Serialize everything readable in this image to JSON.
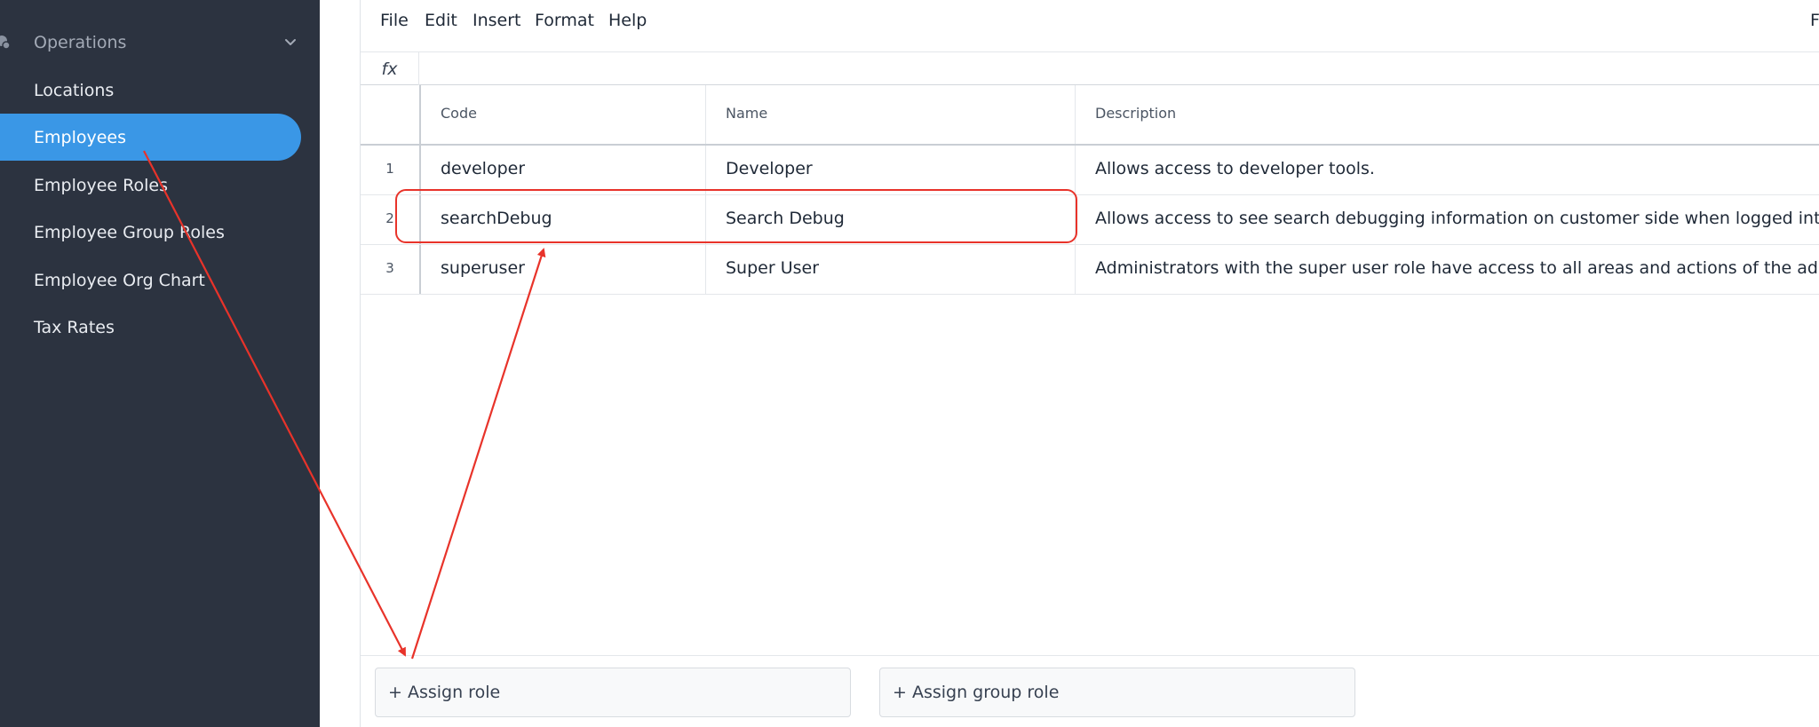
{
  "sidebar": {
    "section": {
      "label": "Operations",
      "icon": "operations-icon"
    },
    "items": [
      {
        "label": "Locations",
        "active": false
      },
      {
        "label": "Employees",
        "active": true
      },
      {
        "label": "Employee Roles",
        "active": false
      },
      {
        "label": "Employee Group Roles",
        "active": false
      },
      {
        "label": "Employee Org Chart",
        "active": false
      },
      {
        "label": "Tax Rates",
        "active": false
      }
    ]
  },
  "menubar": {
    "items": [
      "File",
      "Edit",
      "Insert",
      "Format",
      "Help"
    ],
    "right_partial": "F"
  },
  "formula": {
    "label": "fx",
    "value": ""
  },
  "table": {
    "headers": {
      "code": "Code",
      "name": "Name",
      "description": "Description"
    },
    "rows": [
      {
        "num": "1",
        "code": "developer",
        "name": "Developer",
        "description": "Allows access to developer tools."
      },
      {
        "num": "2",
        "code": "searchDebug",
        "name": "Search Debug",
        "description": "Allows access to see search debugging information on customer side when logged into employe..."
      },
      {
        "num": "3",
        "code": "superuser",
        "name": "Super User",
        "description": "Administrators with the super user role have access to all areas and actions of the administrato..."
      }
    ]
  },
  "footer": {
    "assign_role": "+ Assign role",
    "assign_group_role": "+ Assign group role"
  },
  "colors": {
    "sidebar_bg": "#2c3340",
    "active_item": "#3a97e6",
    "annotation": "#e8332a"
  }
}
